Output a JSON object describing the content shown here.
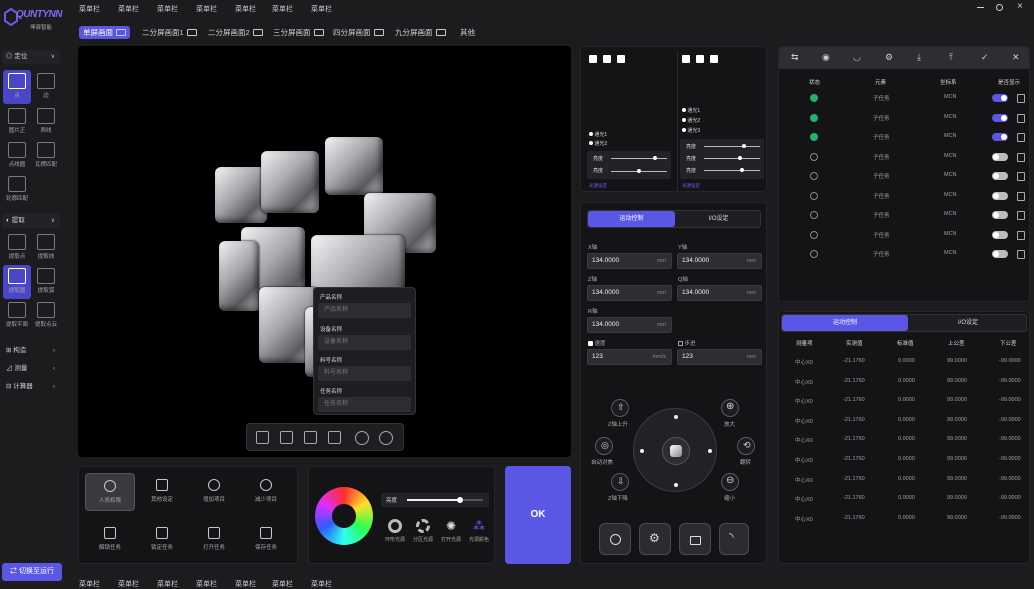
{
  "brand": {
    "logo_text": "QUNTYNN",
    "subtitle": "坤驿智能"
  },
  "menu_bar": [
    "菜单栏",
    "菜单栏",
    "菜单栏",
    "菜单栏",
    "菜单栏",
    "菜单栏",
    "菜单栏",
    "菜单栏"
  ],
  "bottom_menu_bar": [
    "菜单栏",
    "菜单栏",
    "菜单栏",
    "菜单栏",
    "菜单栏",
    "菜单栏",
    "菜单栏",
    "菜单栏"
  ],
  "view_tabs": [
    "单屏画面",
    "二分屏画面1",
    "二分屏画面2",
    "三分屏画面",
    "四分屏画面",
    "九分屏画面",
    "其他"
  ],
  "sidebar": {
    "section_locate": "定位",
    "locate_tools": [
      "点",
      "边",
      "圆片正",
      "两线",
      "点线圆",
      "瓦楞匹配",
      "轮廓匹配"
    ],
    "section_extract": "提取",
    "extract_tools": [
      "提取点",
      "提取线",
      "提取圆",
      "提取弧",
      "提取平面",
      "提取点云"
    ],
    "section_construct": "构造",
    "section_measure": "测量",
    "section_calc": "计算器",
    "switch_button": "切换至运行"
  },
  "form": {
    "product_label": "产品名称",
    "product_placeholder": "产品名称",
    "device_label": "设备名称",
    "device_placeholder": "设备名称",
    "material_label": "料号名称",
    "material_placeholder": "料号名称",
    "task_label": "任务名称",
    "task_placeholder": "任务名称"
  },
  "bottom_tools": [
    "人员权限",
    "其他设定",
    "增加项目",
    "减少项目",
    "解锁任务",
    "锁定任务",
    "打开任务",
    "保存任务"
  ],
  "light": {
    "brightness_label": "亮度",
    "modes": [
      "环形光源",
      "分区光源",
      "打开光源",
      "光源颜色"
    ],
    "brightness_value": 0.7
  },
  "ok_button": "OK",
  "light_panel_a": {
    "channels": [
      "通光1",
      "通光2"
    ],
    "sliders": [
      "亮度",
      "亮度"
    ],
    "link": "光源设定"
  },
  "light_panel_b": {
    "channels": [
      "通光1",
      "通光2",
      "通光3"
    ],
    "sliders": [
      "亮度",
      "亮度",
      "亮度"
    ],
    "link": "光源设定"
  },
  "motion": {
    "tab_active": "运动控制",
    "tab_io": "I/O设定",
    "x_label": "X轴",
    "x_value": "134.0000",
    "y_label": "Y轴",
    "y_value": "134.0000",
    "z_label": "Z轴",
    "z_value": "134.0000",
    "q_label": "Q轴",
    "q_value": "134.0000",
    "r_label": "R轴",
    "r_value": "134.0000",
    "unit": "mm",
    "speed_label": "速度",
    "speed_value": "123",
    "speed_unit": "mm/s",
    "step_label": "步进",
    "step_value": "123",
    "step_unit": "mm",
    "z_up": "Z轴上升",
    "z_down": "Z轴下降",
    "auto_focus": "自动对焦",
    "zoom_in": "放大",
    "zoom_out": "缩小",
    "flip": "翻转"
  },
  "element_table": {
    "headers": [
      "状态",
      "元素",
      "坐标系",
      "是否显示"
    ],
    "rows": [
      {
        "status": "on",
        "element": "子任务",
        "coord": "MCN",
        "show": "on"
      },
      {
        "status": "on",
        "element": "子任务",
        "coord": "MCN",
        "show": "on"
      },
      {
        "status": "on",
        "element": "子任务",
        "coord": "MCN",
        "show": "on"
      },
      {
        "status": "off",
        "element": "子任务",
        "coord": "MCN",
        "show": "off"
      },
      {
        "status": "off",
        "element": "子任务",
        "coord": "MCN",
        "show": "off"
      },
      {
        "status": "off",
        "element": "子任务",
        "coord": "MCN",
        "show": "off"
      },
      {
        "status": "off",
        "element": "子任务",
        "coord": "MCN",
        "show": "off"
      },
      {
        "status": "off",
        "element": "子任务",
        "coord": "MCN",
        "show": "off"
      },
      {
        "status": "off",
        "element": "子任务",
        "coord": "MCN",
        "show": "off"
      }
    ]
  },
  "measure_table": {
    "tab_active": "运动控制",
    "tab_io": "I/O设定",
    "headers": [
      "测量项",
      "实测值",
      "标准值",
      "上公差",
      "下公差"
    ],
    "rows": [
      [
        "中心X0",
        "-21.1760",
        "0.0000",
        "99.0000",
        "-99.0000"
      ],
      [
        "中心X0",
        "-21.1760",
        "0.0000",
        "99.0000",
        "-99.0000"
      ],
      [
        "中心X0",
        "-21.1760",
        "0.0000",
        "99.0000",
        "-99.0000"
      ],
      [
        "中心X0",
        "-21.1760",
        "0.0000",
        "99.0000",
        "-99.0000"
      ],
      [
        "中心X0",
        "-21.1760",
        "0.0000",
        "99.0000",
        "-99.0000"
      ],
      [
        "中心X0",
        "-21.1760",
        "0.0000",
        "99.0000",
        "-99.0000"
      ],
      [
        "中心X0",
        "-21.1760",
        "0.0000",
        "99.0000",
        "-99.0000"
      ],
      [
        "中心X0",
        "-21.1760",
        "0.0000",
        "99.0000",
        "-99.0000"
      ],
      [
        "中心X0",
        "-21.1760",
        "0.0000",
        "99.0000",
        "-99.0000"
      ]
    ]
  },
  "colors": {
    "accent": "#5b57e6",
    "success": "#1fb36b"
  }
}
